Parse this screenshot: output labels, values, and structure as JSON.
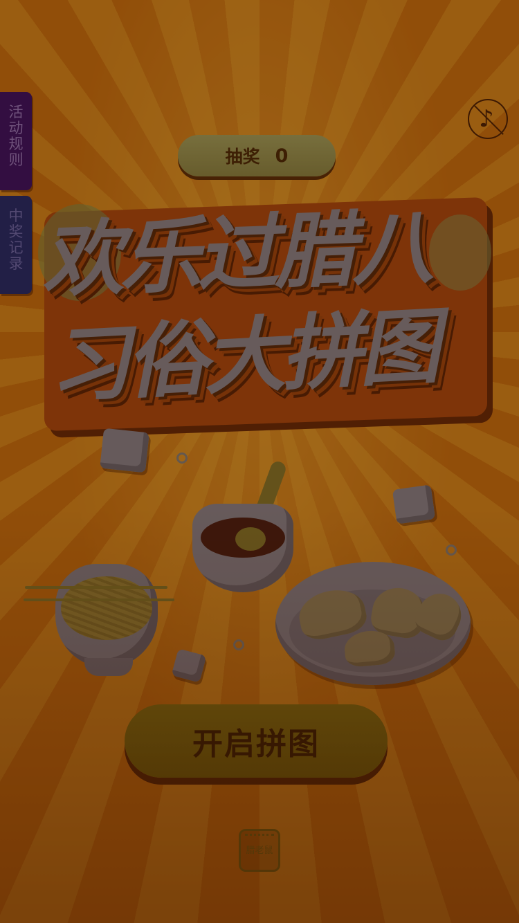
{
  "side_tabs": {
    "rules_label": "活动规则",
    "records_label": "中奖记录"
  },
  "music": {
    "icon": "music-off-icon",
    "glyph": "♪"
  },
  "draw_counter": {
    "label": "抽奖",
    "count": "0"
  },
  "title": {
    "line1": "欢乐过腊八",
    "line2": "习俗大拼图"
  },
  "start_button": {
    "label": "开启拼图"
  },
  "logo": {
    "text": "腊老鼠"
  },
  "colors": {
    "background": "#d2760f",
    "start_button": "#8c7a14",
    "draw_pill": "#a9ab63",
    "title_fill": "#8f8c94"
  }
}
